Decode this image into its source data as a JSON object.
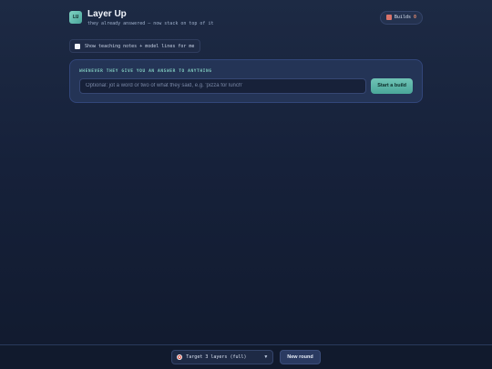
{
  "header": {
    "logo_text": "LU",
    "title": "Layer Up",
    "subtitle": "they already answered — now stack on top of it",
    "builds_label": "Builds",
    "builds_count": "0"
  },
  "toggle": {
    "label": "Show teaching notes + model lines for me",
    "checked": false
  },
  "card": {
    "label": "WHENEVER THEY GIVE YOU AN ANSWER TO ANYTHING",
    "input_placeholder": "Optional: jot a word or two of what they said, e.g. 'pizza for lunch'",
    "input_value": "",
    "start_label": "Start a build"
  },
  "footer": {
    "target_value": "Target  3 layers (full)",
    "new_round_label": "New round"
  },
  "colors": {
    "accent": "#5fb8a9",
    "background": "#16213a",
    "builds_count": "#e38a6f"
  },
  "icons": {
    "builds": "layers-icon",
    "target": "target-icon",
    "dropdown": "chevron-down-icon"
  }
}
